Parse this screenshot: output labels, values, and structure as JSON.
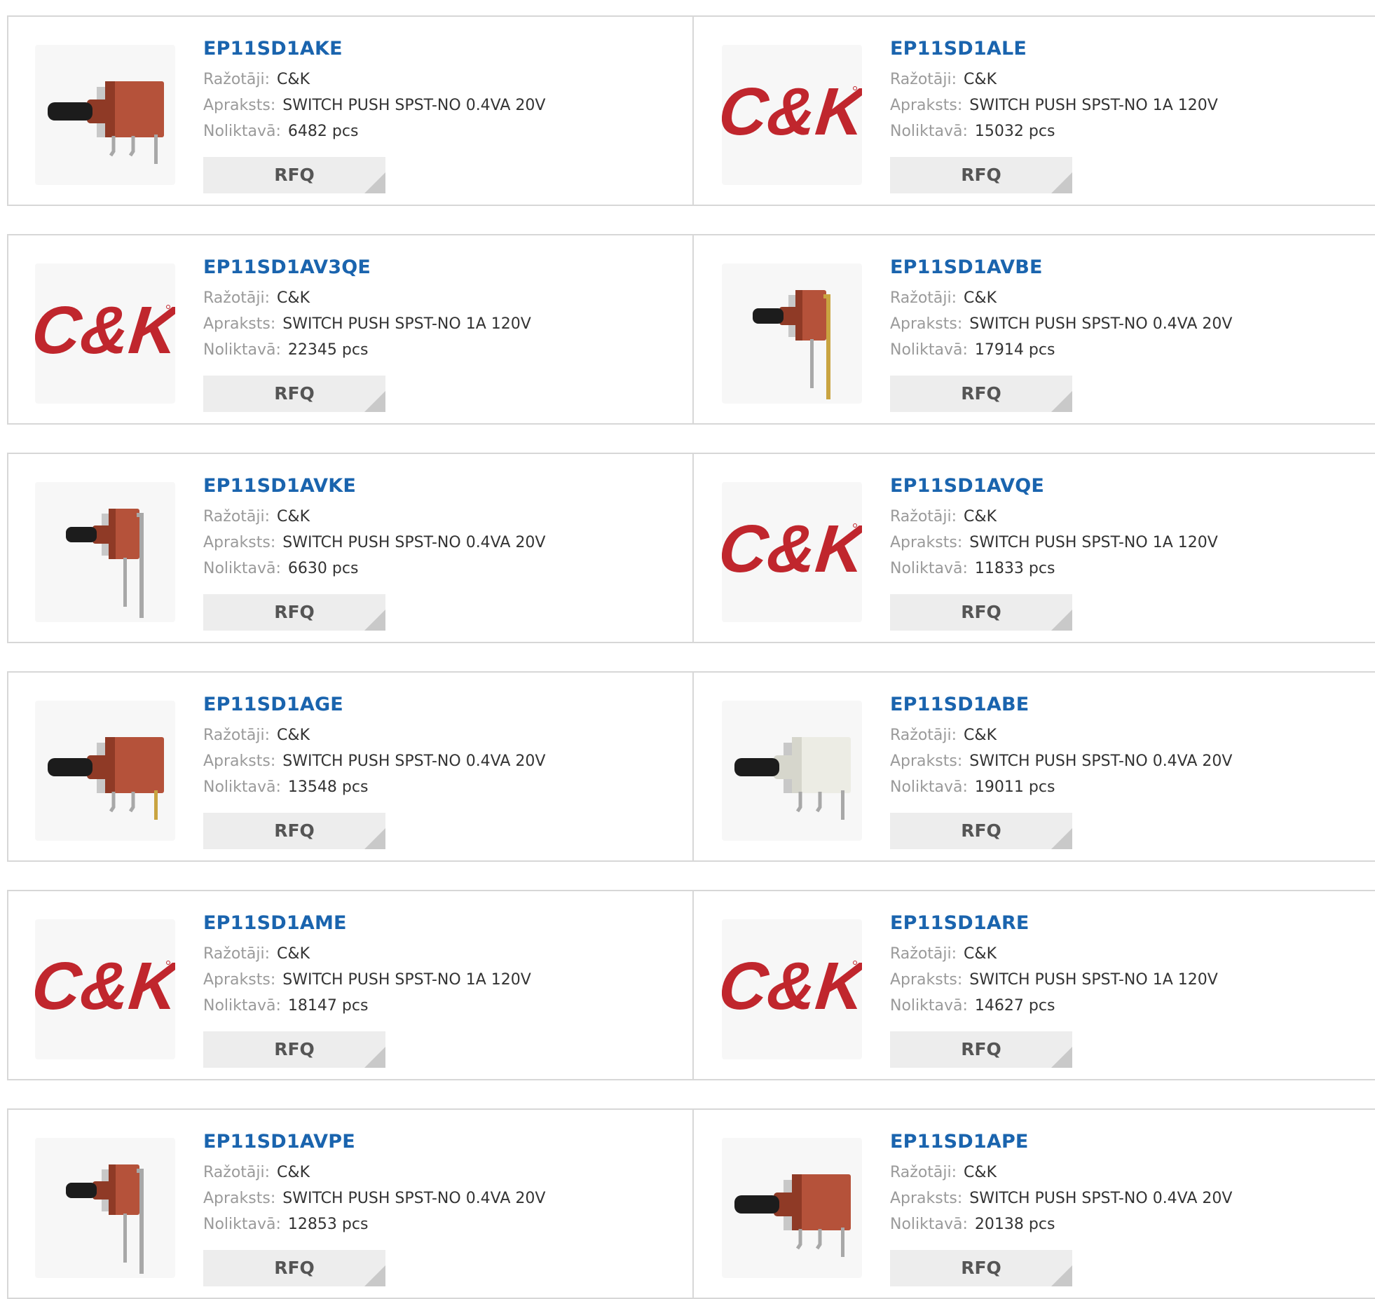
{
  "labels": {
    "manufacturer": "Ražotāji:",
    "description": "Apraksts:",
    "stock": "Noliktavā:",
    "rfq": "RFQ"
  },
  "brand": {
    "logo_text": "C&K",
    "logo_color": "#c0262d",
    "link_color": "#1a64ae"
  },
  "products": [
    {
      "part": "EP11SD1AKE",
      "manufacturer": "C&K",
      "description": "SWITCH PUSH SPST-NO 0.4VA 20V",
      "stock": "6482 pcs",
      "image": "switch-red-side"
    },
    {
      "part": "EP11SD1ALE",
      "manufacturer": "C&K",
      "description": "SWITCH PUSH SPST-NO 1A 120V",
      "stock": "15032 pcs",
      "image": "ck-logo"
    },
    {
      "part": "EP11SD1AV3QE",
      "manufacturer": "C&K",
      "description": "SWITCH PUSH SPST-NO 1A 120V",
      "stock": "22345 pcs",
      "image": "ck-logo"
    },
    {
      "part": "EP11SD1AVBE",
      "manufacturer": "C&K",
      "description": "SWITCH PUSH SPST-NO 0.4VA 20V",
      "stock": "17914 pcs",
      "image": "switch-red-vertical-gold"
    },
    {
      "part": "EP11SD1AVKE",
      "manufacturer": "C&K",
      "description": "SWITCH PUSH SPST-NO 0.4VA 20V",
      "stock": "6630 pcs",
      "image": "switch-red-vertical"
    },
    {
      "part": "EP11SD1AVQE",
      "manufacturer": "C&K",
      "description": "SWITCH PUSH SPST-NO 1A 120V",
      "stock": "11833 pcs",
      "image": "ck-logo"
    },
    {
      "part": "EP11SD1AGE",
      "manufacturer": "C&K",
      "description": "SWITCH PUSH SPST-NO 0.4VA 20V",
      "stock": "13548 pcs",
      "image": "switch-red-side-gold"
    },
    {
      "part": "EP11SD1ABE",
      "manufacturer": "C&K",
      "description": "SWITCH PUSH SPST-NO 0.4VA 20V",
      "stock": "19011 pcs",
      "image": "switch-white-side"
    },
    {
      "part": "EP11SD1AME",
      "manufacturer": "C&K",
      "description": "SWITCH PUSH SPST-NO 1A 120V",
      "stock": "18147 pcs",
      "image": "ck-logo"
    },
    {
      "part": "EP11SD1ARE",
      "manufacturer": "C&K",
      "description": "SWITCH PUSH SPST-NO 1A 120V",
      "stock": "14627 pcs",
      "image": "ck-logo"
    },
    {
      "part": "EP11SD1AVPE",
      "manufacturer": "C&K",
      "description": "SWITCH PUSH SPST-NO 0.4VA 20V",
      "stock": "12853 pcs",
      "image": "switch-red-vertical"
    },
    {
      "part": "EP11SD1APE",
      "manufacturer": "C&K",
      "description": "SWITCH PUSH SPST-NO 0.4VA 20V",
      "stock": "20138 pcs",
      "image": "switch-red-side"
    }
  ]
}
